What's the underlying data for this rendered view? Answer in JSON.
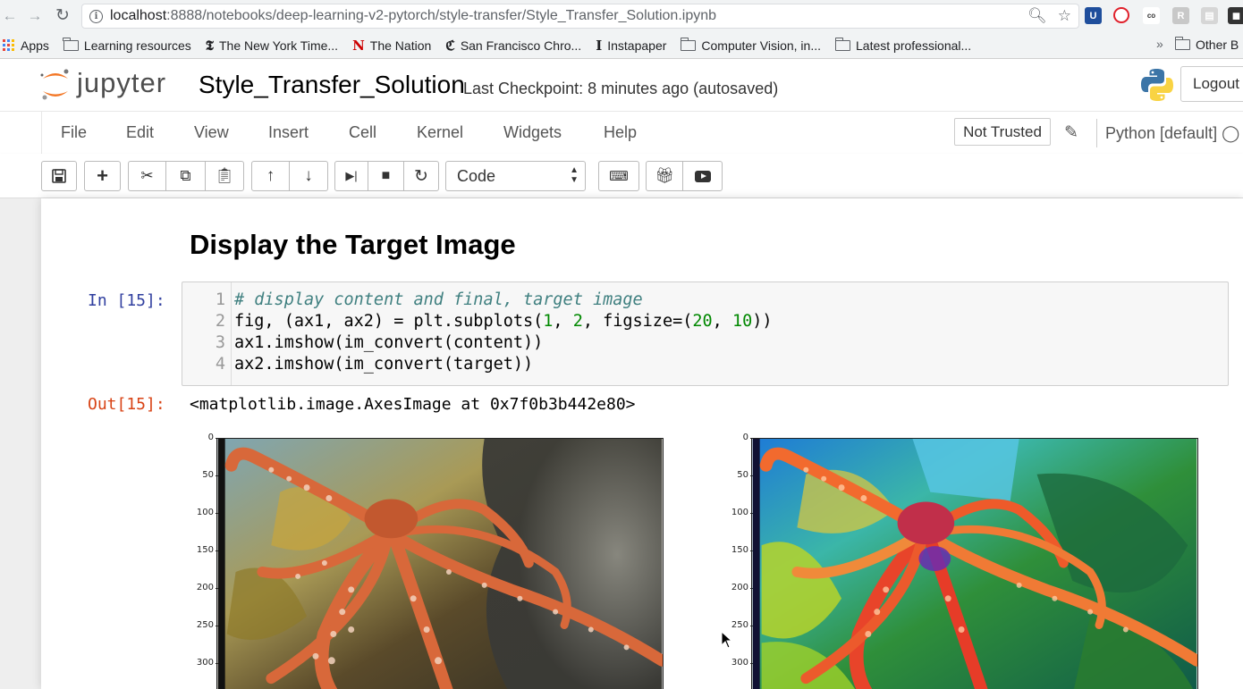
{
  "browser": {
    "url_host": "localhost",
    "url_rest": ":8888/notebooks/deep-learning-v2-pytorch/style-transfer/Style_Transfer_Solution.ipynb",
    "bookmarks": [
      {
        "label": "Apps",
        "icon": "apps-grid-icon"
      },
      {
        "label": "Learning resources",
        "icon": "folder-icon"
      },
      {
        "label": "The New York Time...",
        "icon": "nyt-icon"
      },
      {
        "label": "The Nation",
        "icon": "nation-icon"
      },
      {
        "label": "San Francisco Chro...",
        "icon": "sfchronicle-icon"
      },
      {
        "label": "Instapaper",
        "icon": "instapaper-icon"
      },
      {
        "label": "Computer Vision, in...",
        "icon": "folder-icon"
      },
      {
        "label": "Latest professional...",
        "icon": "folder-icon"
      }
    ],
    "overflow": "»",
    "other_bookmarks": "Other B"
  },
  "jupyter": {
    "logo_text": "jupyter",
    "notebook_title": "Style_Transfer_Solution",
    "checkpoint": "Last Checkpoint: 8 minutes ago (autosaved)",
    "logout_label": "Logout",
    "menu": [
      "File",
      "Edit",
      "View",
      "Insert",
      "Cell",
      "Kernel",
      "Widgets",
      "Help"
    ],
    "trust_status": "Not Trusted",
    "kernel": "Python [default]",
    "cell_type": "Code"
  },
  "notebook": {
    "heading": "Display the Target Image",
    "in_prompt": "In [15]:",
    "code_lines": [
      {
        "n": "1",
        "parts": [
          {
            "t": "# display content and final, target image",
            "c": "cm"
          }
        ]
      },
      {
        "n": "2",
        "parts": [
          {
            "t": "fig, (ax1, ax2) = plt.subplots(",
            "c": ""
          },
          {
            "t": "1",
            "c": "num"
          },
          {
            "t": ", ",
            "c": ""
          },
          {
            "t": "2",
            "c": "num"
          },
          {
            "t": ", figsize=(",
            "c": ""
          },
          {
            "t": "20",
            "c": "num"
          },
          {
            "t": ", ",
            "c": ""
          },
          {
            "t": "10",
            "c": "num"
          },
          {
            "t": "))",
            "c": ""
          }
        ]
      },
      {
        "n": "3",
        "parts": [
          {
            "t": "ax1.imshow(im_convert(content))",
            "c": ""
          }
        ]
      },
      {
        "n": "4",
        "parts": [
          {
            "t": "ax2.imshow(im_convert(target))",
            "c": ""
          }
        ]
      }
    ],
    "out_prompt": "Out[15]:",
    "out_text": "<matplotlib.image.AxesImage at 0x7f0b3b442e80>"
  },
  "plots": [
    {
      "name": "content-image-axes",
      "yticks": [
        "0",
        "50",
        "100",
        "150",
        "200",
        "250",
        "300"
      ],
      "style": "photo"
    },
    {
      "name": "target-image-axes",
      "yticks": [
        "0",
        "50",
        "100",
        "150",
        "200",
        "250",
        "300"
      ],
      "style": "stylized"
    }
  ]
}
